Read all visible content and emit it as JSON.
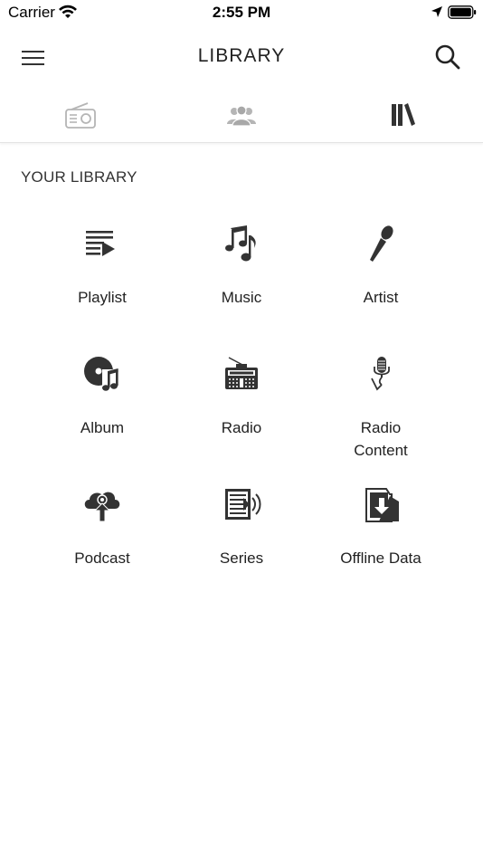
{
  "status_bar": {
    "carrier": "Carrier",
    "time": "2:55 PM"
  },
  "nav": {
    "title": "LIBRARY",
    "menu_icon": "hamburger-menu-icon",
    "search_icon": "search-icon"
  },
  "tabs": [
    {
      "icon": "radio-icon",
      "active": false
    },
    {
      "icon": "users-icon",
      "active": false
    },
    {
      "icon": "library-books-icon",
      "active": true
    }
  ],
  "library": {
    "section_title": "YOUR LIBRARY",
    "items": [
      {
        "label": "Playlist",
        "icon": "playlist-icon"
      },
      {
        "label": "Music",
        "icon": "music-notes-icon"
      },
      {
        "label": "Artist",
        "icon": "microphone-icon"
      },
      {
        "label": "Album",
        "icon": "album-disc-icon"
      },
      {
        "label": "Radio",
        "icon": "radio-receiver-icon"
      },
      {
        "label": "Radio\nContent",
        "icon": "studio-microphone-icon"
      },
      {
        "label": "Podcast",
        "icon": "podcast-upload-icon"
      },
      {
        "label": "Series",
        "icon": "series-broadcast-icon"
      },
      {
        "label": "Offline Data",
        "icon": "offline-download-icon"
      }
    ]
  },
  "colors": {
    "icon_active": "#333333",
    "icon_inactive": "#b5b5b5",
    "text": "#222222"
  }
}
